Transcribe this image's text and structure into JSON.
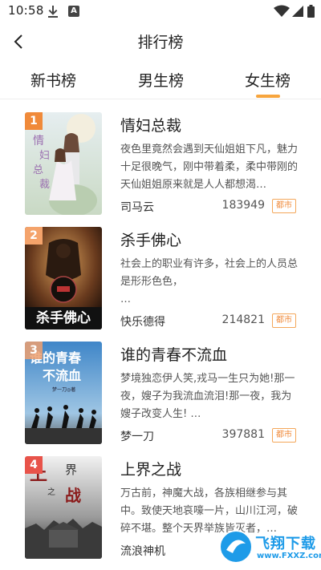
{
  "status_bar": {
    "time": "10:58",
    "a_label": "A"
  },
  "header": {
    "title": "排行榜"
  },
  "tabs": [
    {
      "label": "新书榜",
      "active": false
    },
    {
      "label": "男生榜",
      "active": false
    },
    {
      "label": "女生榜",
      "active": true
    }
  ],
  "colors": {
    "accent": "#f7a53d",
    "tag": "#f08a3a",
    "badge_1": "#f08a3a",
    "badge_2": "#f4a36b",
    "badge_3": "#f6b98e",
    "badge_4": "#e8534a"
  },
  "books": [
    {
      "rank": "1",
      "title": "情妇总裁",
      "description": "夜色里竟然会遇到天仙姐姐下凡，魅力十足很晚气，刚中带着柔，柔中带刚的天仙姐姐原来就是人人都想渴…",
      "author": "司马云",
      "count": "183949",
      "tag": "都市",
      "cover_text": "情妇总裁"
    },
    {
      "rank": "2",
      "title": "杀手佛心",
      "description": "社会上的职业有许多，社会上的人员总是形形色色，\n…",
      "author": "快乐德得",
      "count": "214821",
      "tag": "都市",
      "cover_text": "杀手佛心"
    },
    {
      "rank": "3",
      "title": "谁的青春不流血",
      "description": "梦境独恋伊人笑,戎马一生只为她!那一夜，嫂子为我流血流泪!那一夜，我为嫂子改变人生! …",
      "author": "梦一刀",
      "count": "397881",
      "tag": "都市",
      "cover_text": "谁的青春不流血",
      "cover_sub": "梦一刀◎著"
    },
    {
      "rank": "4",
      "title": "上界之战",
      "description": "万古前，神魔大战，各族相继参与其中。致使天地哀嚎一片，山川江河，破碎不堪。整个天界举族皆灭者，…",
      "author": "流浪神机",
      "count": "",
      "tag": "",
      "cover_text": "上界之战"
    }
  ],
  "watermark": {
    "text": "飞翔下载",
    "sub": "www.FXXZ.com"
  }
}
